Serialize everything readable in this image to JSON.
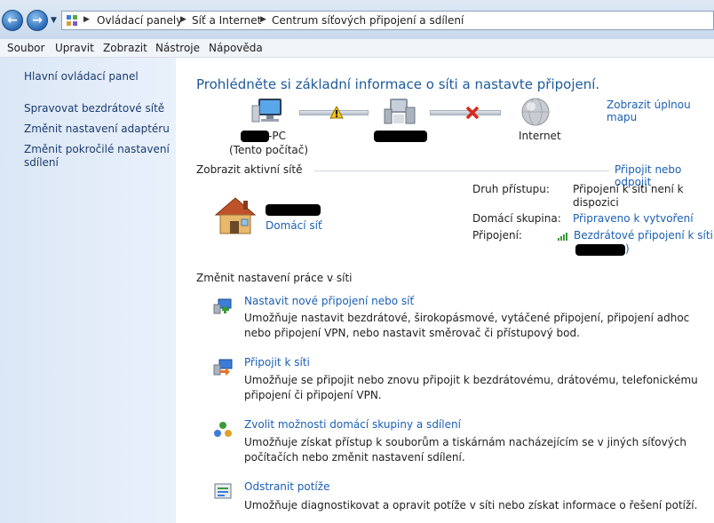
{
  "breadcrumb": [
    "Ovládací panely",
    "Síť a Internet",
    "Centrum síťových připojení a sdílení"
  ],
  "menu": [
    "Soubor",
    "Upravit",
    "Zobrazit",
    "Nástroje",
    "Nápověda"
  ],
  "sidebar": {
    "home": "Hlavní ovládací panel",
    "links": [
      "Spravovat bezdrátové sítě",
      "Změnit nastavení adaptéru",
      "Změnit pokročilé nastavení sdílení"
    ]
  },
  "main": {
    "title": "Prohlédněte si základní informace o síti a nastavte připojení.",
    "full_map": "Zobrazit úplnou mapu",
    "map": {
      "pc_suffix": "-PC",
      "pc_note": "(Tento počítač)",
      "internet": "Internet"
    },
    "active_networks": {
      "heading": "Zobrazit aktivní sítě",
      "action": "Připojit nebo odpojit",
      "network_type": "Domácí síť",
      "access_label": "Druh přístupu:",
      "access_value": "Připojení k síti není k dispozici",
      "homegroup_label": "Domácí skupina:",
      "homegroup_value": "Připraveno k vytvoření",
      "connection_label": "Připojení:",
      "connection_value": "Bezdrátové připojení k síti",
      "connection_close": ")"
    },
    "change_settings": {
      "heading": "Změnit nastavení práce v síti",
      "tasks": [
        {
          "title": "Nastavit nové připojení nebo síť",
          "desc": "Umožňuje nastavit bezdrátové, širokopásmové, vytáčené připojení, připojení adhoc nebo připojení VPN, nebo nastavit směrovač či přístupový bod."
        },
        {
          "title": "Připojit k síti",
          "desc": "Umožňuje se připojit nebo znovu připojit k bezdrátovému, drátovému, telefonickému připojení či připojení VPN."
        },
        {
          "title": "Zvolit možnosti domácí skupiny a sdílení",
          "desc": "Umožňuje získat přístup k souborům a tiskárnám nacházejícím se v jiných síťových počítačích nebo změnit nastavení sdílení."
        },
        {
          "title": "Odstranit potíže",
          "desc": "Umožňuje diagnostikovat a opravit potíže v síti nebo získat informace o řešení potíží."
        }
      ]
    }
  }
}
